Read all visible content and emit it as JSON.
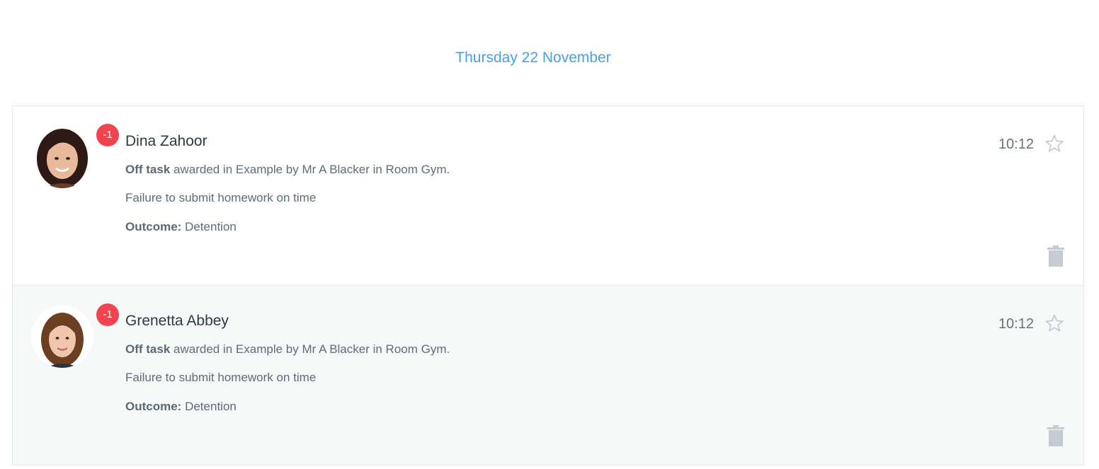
{
  "date_heading": "Thursday 22 November",
  "entries": [
    {
      "name": "Dina Zahoor",
      "badge": "-1",
      "time": "10:12",
      "behaviour": "Off task",
      "details": "awarded in Example by Mr A Blacker in Room Gym.",
      "note": "Failure to submit homework on time",
      "outcome_label": "Outcome:",
      "outcome_value": "Detention"
    },
    {
      "name": "Grenetta Abbey",
      "badge": "-1",
      "time": "10:12",
      "behaviour": "Off task",
      "details": "awarded in Example by Mr A Blacker in Room Gym.",
      "note": "Failure to submit homework on time",
      "outcome_label": "Outcome:",
      "outcome_value": "Detention"
    }
  ],
  "colors": {
    "accent": "#4a9fe8",
    "badge": "#f2434f",
    "icon_grey": "#c5ccd1"
  },
  "icons": [
    "star-icon",
    "trash-icon"
  ]
}
